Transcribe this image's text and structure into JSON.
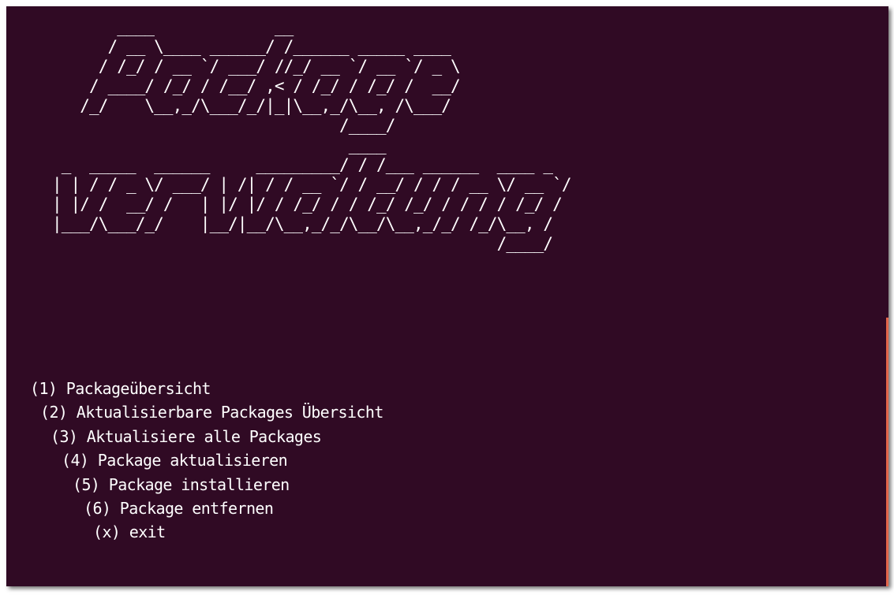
{
  "terminal": {
    "background": "#300a24",
    "foreground": "#ffffff",
    "scrollbar_color": "#e2664a"
  },
  "banner": {
    "lines": [
      "       ____             __",
      "      / __ \\____ ______/ /______ _____ ____",
      "     / /_/ / __ `/ ___/ //_/ __ `/ __ `/ _ \\",
      "    / ____/ /_/ / /__/ ,< / /_/ / /_/ /  __/",
      "   /_/    \\__,_/\\___/_/|_|\\__,_/\\__, /\\___/",
      "                               /____/",
      "                                ____",
      " _  _____  ______     _________/ / /___ ______  ____ _",
      "| | / / _ \\/ ___/ | /| / / __ `/ / __/ / / / __ \\/ __ `/",
      "| |/ /  __/ /   | |/ |/ / /_/ / / /_/ /_/ / / / / /_/ /",
      "|___/\\___/_/    |__/|__/\\__,_/_/\\__/\\__,_/_/ /_/\\__, /",
      "                                                /____/"
    ]
  },
  "menu": {
    "items": [
      {
        "label": "(1) Packageübersicht"
      },
      {
        "label": "(2) Aktualisierbare Packages Übersicht"
      },
      {
        "label": "(3) Aktualisiere alle Packages"
      },
      {
        "label": "(4) Package aktualisieren"
      },
      {
        "label": "(5) Package installieren"
      },
      {
        "label": "(6) Package entfernen"
      },
      {
        "label": "(x) exit"
      }
    ]
  }
}
